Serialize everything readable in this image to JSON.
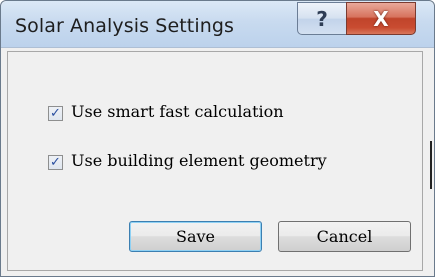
{
  "window": {
    "title": "Solar Analysis Settings",
    "help_glyph": "?",
    "close_glyph": "X"
  },
  "options": [
    {
      "label": "Use smart fast calculation",
      "checked": true
    },
    {
      "label": "Use building element geometry",
      "checked": true
    }
  ],
  "checkmark_glyph": "✓",
  "buttons": {
    "save_label": "Save",
    "cancel_label": "Cancel"
  },
  "colors": {
    "close_button": "#c94c31",
    "titlebar": "#c8daef",
    "check_accent": "#2a4fa0"
  }
}
